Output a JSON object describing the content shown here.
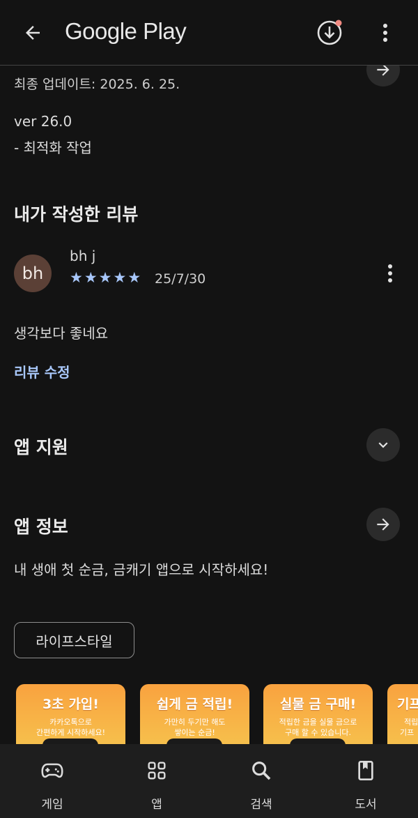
{
  "appbar": {
    "title": "Google Play"
  },
  "whats_new": {
    "updated": "최종 업데이트: 2025. 6. 25.",
    "version": "ver 26.0",
    "note": "- 최적화 작업"
  },
  "my_review": {
    "heading": "내가 작성한 리뷰",
    "avatar_initials": "bh",
    "user": "bh j",
    "rating": 5,
    "date": "25/7/30",
    "text": "생각보다 좋네요",
    "edit_label": "리뷰 수정"
  },
  "app_support": {
    "heading": "앱 지원"
  },
  "app_info": {
    "heading": "앱 정보",
    "description": "내 생애 첫 순금, 금캐기 앱으로 시작하세요!",
    "category_chip": "라이프스타일"
  },
  "screenshots": [
    {
      "headline": "3초 가입!",
      "sub1": "카카오톡으로",
      "sub2": "간편하게 시작하세요!"
    },
    {
      "headline": "쉽게 금 적립!",
      "sub1": "가만히 두기만 해도",
      "sub2": "쌓이는 순금!"
    },
    {
      "headline": "실물 금 구매!",
      "sub1": "적립한 금을 실물 금으로",
      "sub2": "구매 할 수 있습니다."
    },
    {
      "headline": "기프",
      "sub1": "적립",
      "sub2": "기프"
    }
  ],
  "bottom_nav": [
    {
      "label": "게임",
      "icon": "gamepad-icon"
    },
    {
      "label": "앱",
      "icon": "apps-grid-icon"
    },
    {
      "label": "검색",
      "icon": "search-icon"
    },
    {
      "label": "도서",
      "icon": "book-icon"
    }
  ],
  "colors": {
    "accent": "#a8c7fa",
    "background": "#131313",
    "avatar": "#5b4036"
  }
}
